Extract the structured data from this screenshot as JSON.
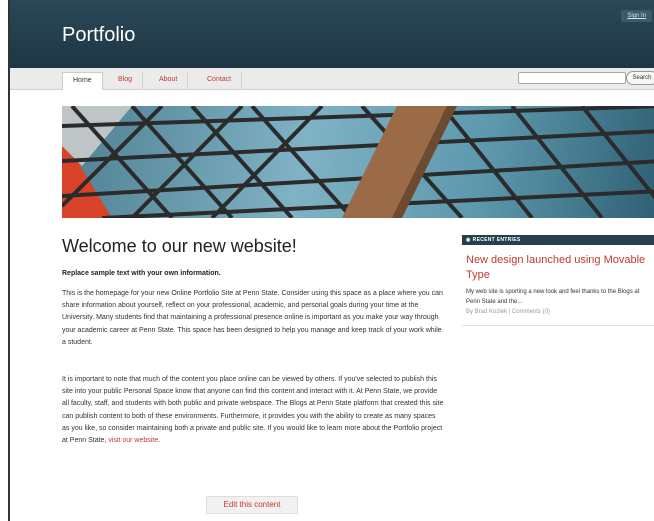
{
  "header": {
    "site_title": "Portfolio",
    "sign_in": "Sign In"
  },
  "nav": {
    "items": [
      {
        "label": "Home",
        "active": true
      },
      {
        "label": "Blog",
        "active": false
      },
      {
        "label": "About",
        "active": false
      },
      {
        "label": "Contact",
        "active": false
      }
    ],
    "search_button": "Search"
  },
  "main": {
    "title": "Welcome to our new website!",
    "subtitle": "Replace sample text with your own information.",
    "paragraph1": "This is the homepage for your new Online Portfolio Site at Penn State. Consider using this space as a place where you can share information about yourself, reflect on your professional, academic, and personal goals during your time at the University. Many students find that maintaining a professional presence online is important as you make your way through your academic career at Penn State. This space has been designed to help you manage and keep track of your work while a student.",
    "paragraph2": "It is important to note that much of the content you place online can be viewed by others. If you've selected to publish this site into your public Personal Space know that anyone can find this content and interact with it. At Penn State, we provide all faculty, staff, and students with both public and private webspace. The Blogs at Penn State platform that created this site can publish content to both of these environments. Furthermore, it provides you with the ability to create as many spaces as you like, so consider maintaining both a private and public site. If you would like to learn more about the Portfolio project at Penn State, ",
    "link_text": "visit our website",
    "link_suffix": ".",
    "edit_button": "Edit this content"
  },
  "sidebar": {
    "header": "RECENT ENTRIES",
    "entry_title": "New design launched using Movable Type",
    "entry_excerpt": "My web site is sporting a new look and feel thanks to the Blogs at Penn State and the...",
    "entry_meta": "By Brad Kozlek | Comments (0)"
  },
  "colors": {
    "header_bg": "#1e3644",
    "accent": "#c23b2a",
    "sidebar_header_bg": "#253f4d"
  }
}
